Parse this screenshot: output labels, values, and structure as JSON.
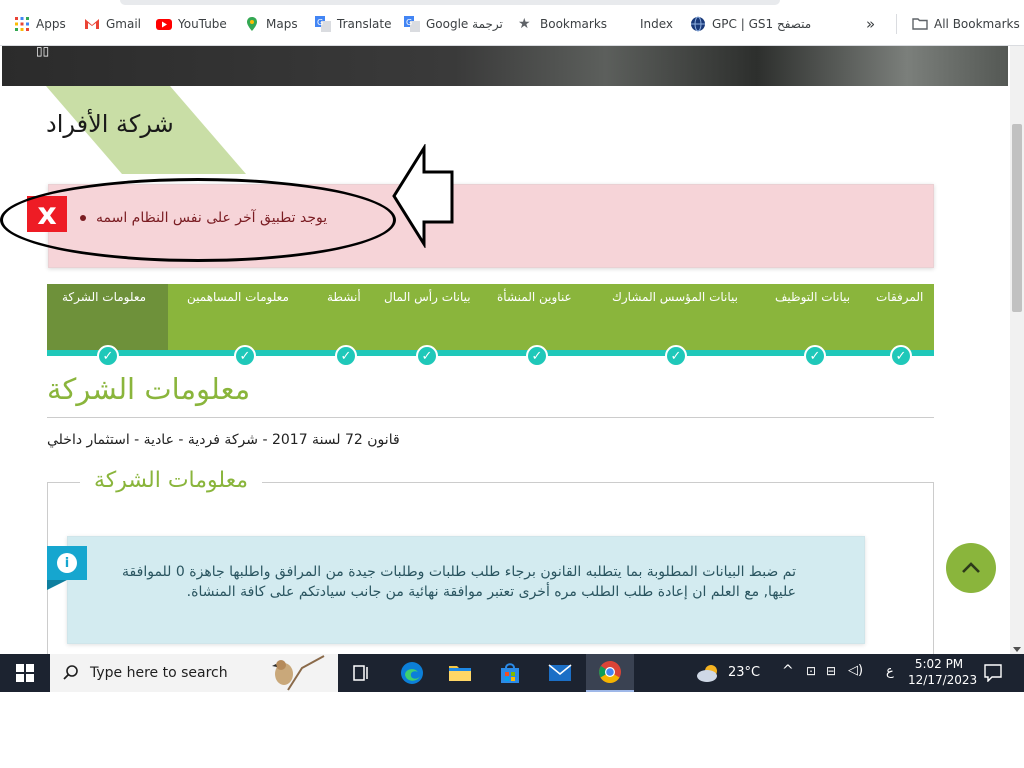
{
  "bookmarks": [
    {
      "label": "Apps",
      "icon": "apps-grid-icon"
    },
    {
      "label": "Gmail",
      "icon": "gmail-icon"
    },
    {
      "label": "YouTube",
      "icon": "youtube-icon"
    },
    {
      "label": "Maps",
      "icon": "maps-pin-icon"
    },
    {
      "label": "Translate",
      "icon": "translate-icon"
    },
    {
      "label": "Google ترجمة",
      "icon": "translate-icon"
    },
    {
      "label": "Bookmarks",
      "icon": "star-icon"
    },
    {
      "label": "Index",
      "icon": ""
    },
    {
      "label": "GPC | GS1 متصفح",
      "icon": "globe-icon"
    }
  ],
  "bookmarks_overflow": "»",
  "all_bookmarks": "All Bookmarks",
  "page": {
    "company_title": "شركة الأفراد",
    "alert_message": "يوجد تطبيق آخر على نفس النظام اسمه",
    "alert_icon": "x",
    "steps": [
      {
        "label": "المرفقات",
        "done": true
      },
      {
        "label": "بيانات التوظيف",
        "done": true
      },
      {
        "label": "بيانات المؤسس المشارك",
        "done": true
      },
      {
        "label": "عناوين المنشأة",
        "done": true
      },
      {
        "label": "بيانات رأس المال",
        "done": true
      },
      {
        "label": "أنشطة",
        "done": true
      },
      {
        "label": "معلومات المساهمين",
        "done": true
      },
      {
        "label": "معلومات الشركة",
        "done": true,
        "active": true
      }
    ],
    "section_heading": "معلومات الشركة",
    "law_text": "قانون 72 لسنة 2017 - شركة فردية - عادية - استثمار داخلي",
    "fieldset_legend": "معلومات الشركة",
    "info_text": "تم ضبط البيانات المطلوبة بما يتطلبه القانون برجاء طلب طلبات وطلبات جيدة من المرافق واطلبها جاهزة 0 للموافقة عليها, مع العلم ان إعادة طلب الطلب مره أخرى تعتبر موافقة نهائية من جانب سيادتكم على كافة المنشاة."
  },
  "taskbar": {
    "search_placeholder": "Type here to search",
    "weather": "23°C",
    "lang": "ع",
    "time": "5:02 PM",
    "date": "12/17/2023"
  },
  "colors": {
    "brand_green": "#8ab53c",
    "active_step": "#6e913a",
    "teal": "#1fc8b9",
    "alert_bg": "#f6d4d8",
    "alert_text": "#7a1c22",
    "info_bg": "#d3ebf0",
    "info_icon": "#16a6cf"
  }
}
